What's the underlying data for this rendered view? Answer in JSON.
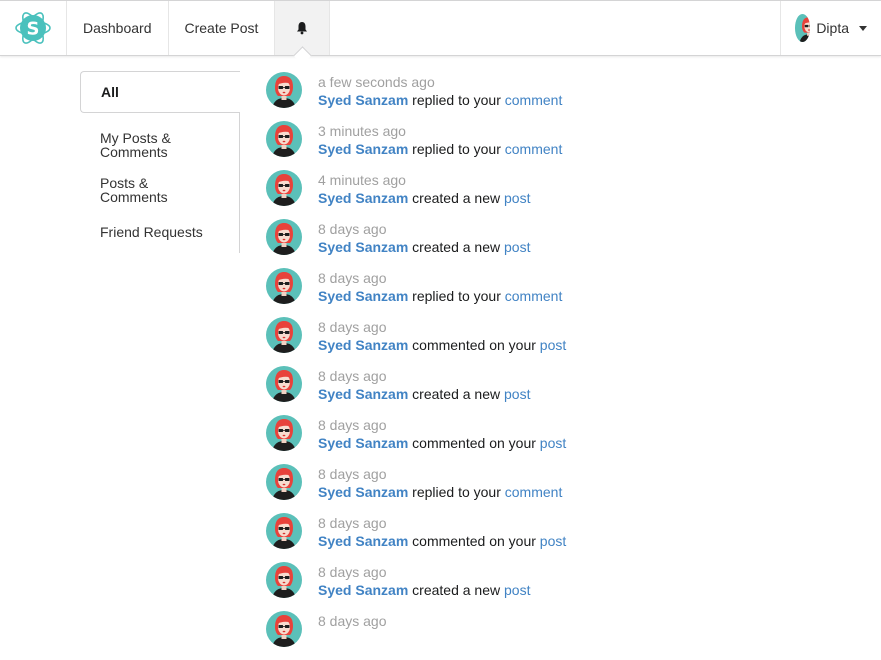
{
  "colors": {
    "logo_teal": "#4ac1bd",
    "link_blue": "#4183c4",
    "avatar_bg": "#5bc0b9",
    "avatar_hair": "#e8423b"
  },
  "navbar": {
    "logo_icon": "atom-s-logo-icon",
    "dashboard_label": "Dashboard",
    "create_post_label": "Create Post",
    "bell_icon": "bell-icon",
    "user_name": "Dipta",
    "user_caret_icon": "caret-down-icon"
  },
  "sidebar": {
    "items": [
      {
        "label": "All",
        "active": true
      },
      {
        "label": "My Posts & Comments",
        "active": false
      },
      {
        "label": "Posts & Comments",
        "active": false
      },
      {
        "label": "Friend Requests",
        "active": false
      }
    ]
  },
  "feed": {
    "items": [
      {
        "date": "a few seconds ago",
        "actor": "Syed Sanzam",
        "action": "replied to your",
        "target": "comment"
      },
      {
        "date": "3 minutes ago",
        "actor": "Syed Sanzam",
        "action": "replied to your",
        "target": "comment"
      },
      {
        "date": "4 minutes ago",
        "actor": "Syed Sanzam",
        "action": "created a new",
        "target": "post"
      },
      {
        "date": "8 days ago",
        "actor": "Syed Sanzam",
        "action": "created a new",
        "target": "post"
      },
      {
        "date": "8 days ago",
        "actor": "Syed Sanzam",
        "action": "replied to your",
        "target": "comment"
      },
      {
        "date": "8 days ago",
        "actor": "Syed Sanzam",
        "action": "commented on your",
        "target": "post"
      },
      {
        "date": "8 days ago",
        "actor": "Syed Sanzam",
        "action": "created a new",
        "target": "post"
      },
      {
        "date": "8 days ago",
        "actor": "Syed Sanzam",
        "action": "commented on your",
        "target": "post"
      },
      {
        "date": "8 days ago",
        "actor": "Syed Sanzam",
        "action": "replied to your",
        "target": "comment"
      },
      {
        "date": "8 days ago",
        "actor": "Syed Sanzam",
        "action": "commented on your",
        "target": "post"
      },
      {
        "date": "8 days ago",
        "actor": "Syed Sanzam",
        "action": "created a new",
        "target": "post"
      },
      {
        "date": "8 days ago",
        "actor": "",
        "action": "",
        "target": ""
      }
    ]
  }
}
